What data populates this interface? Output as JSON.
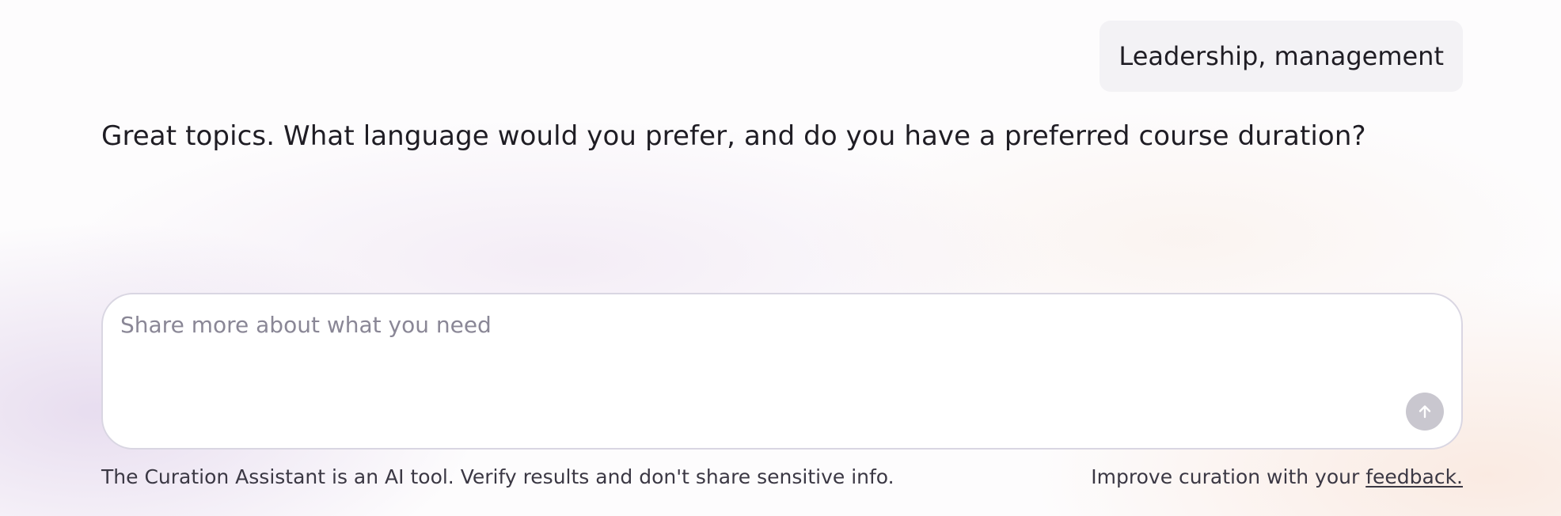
{
  "conversation": {
    "user_message": "Leadership, management",
    "assistant_message": "Great topics. What language would you prefer, and do you have a preferred course duration?"
  },
  "composer": {
    "placeholder": "Share more about what you need",
    "value": "",
    "send_icon": "arrow-up-icon"
  },
  "footer": {
    "disclaimer": "The Curation Assistant is an AI tool. Verify results and don't share sensitive info.",
    "feedback_prefix": "Improve curation with your ",
    "feedback_link": "feedback."
  },
  "colors": {
    "send_button_disabled": "#c9c7cf",
    "user_bubble_bg": "#f3f2f5",
    "composer_border": "#d9d6e2"
  }
}
